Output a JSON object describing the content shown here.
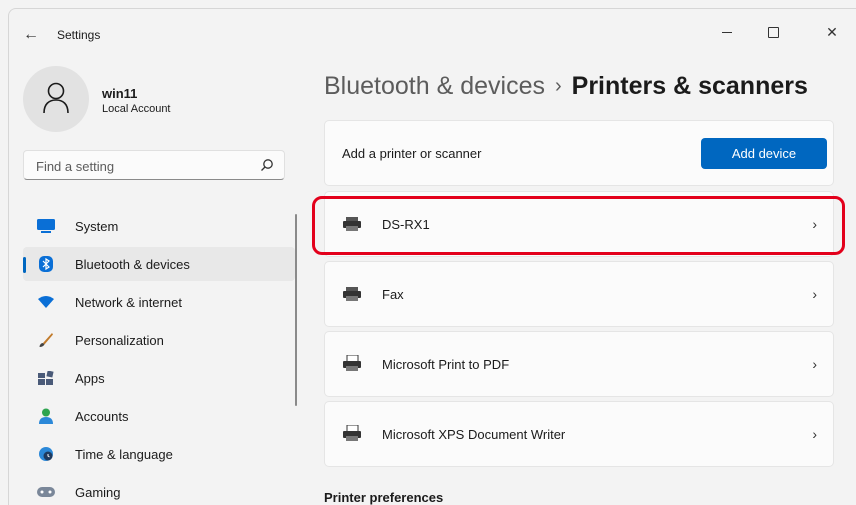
{
  "window": {
    "title": "Settings",
    "controls": {
      "minimize": "minimize-icon",
      "maximize": "maximize-icon",
      "close": "close-icon"
    }
  },
  "profile": {
    "name": "win11",
    "account_type": "Local Account"
  },
  "search": {
    "placeholder": "Find a setting",
    "value": ""
  },
  "nav": {
    "items": [
      {
        "label": "System",
        "icon": "monitor-icon",
        "active": false
      },
      {
        "label": "Bluetooth & devices",
        "icon": "bluetooth-icon",
        "active": true
      },
      {
        "label": "Network & internet",
        "icon": "wifi-icon",
        "active": false
      },
      {
        "label": "Personalization",
        "icon": "brush-icon",
        "active": false
      },
      {
        "label": "Apps",
        "icon": "apps-icon",
        "active": false
      },
      {
        "label": "Accounts",
        "icon": "person-icon",
        "active": false
      },
      {
        "label": "Time & language",
        "icon": "globe-clock-icon",
        "active": false
      },
      {
        "label": "Gaming",
        "icon": "gamepad-icon",
        "active": false
      }
    ]
  },
  "header": {
    "parent": "Bluetooth & devices",
    "separator": "›",
    "current": "Printers & scanners"
  },
  "add_printer": {
    "label": "Add a printer or scanner",
    "button": "Add device"
  },
  "devices": [
    {
      "name": "DS-RX1",
      "icon": "printer-icon",
      "highlighted": true
    },
    {
      "name": "Fax",
      "icon": "printer-icon",
      "highlighted": false
    },
    {
      "name": "Microsoft Print to PDF",
      "icon": "printer-document-icon",
      "highlighted": false
    },
    {
      "name": "Microsoft XPS Document Writer",
      "icon": "printer-document-icon",
      "highlighted": false
    }
  ],
  "section_heading": "Printer preferences",
  "colors": {
    "accent": "#0067c0",
    "highlight": "#e3001b",
    "background": "#f3f3f3",
    "card": "#fbfbfb"
  }
}
